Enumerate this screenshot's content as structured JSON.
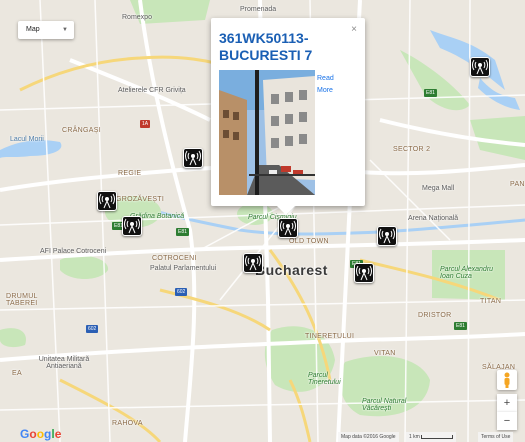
{
  "map_type": {
    "label": "Map"
  },
  "popup": {
    "title": "361WK50113-BUCURESTI 7",
    "read_more": "Read More",
    "close": "×"
  },
  "labels": {
    "romexpo": "Romexpo",
    "promenada": "Promenada",
    "atelierele": "Atelierele CFR Grivița",
    "lacul_morii": "Lacul Morii",
    "crangasi": "CRÂNGAȘI",
    "regie": "REGIE",
    "grozavesti": "GROZĂVEȘTI",
    "gradina_botanica": "Grădina Botanică",
    "afi": "AFI Palace Cotroceni",
    "cotroceni": "COTROCENI",
    "palatul": "Palatul Parlamentului",
    "parcul_cismigiu": "Parcul Cișmigiu",
    "old_town": "OLD TOWN",
    "bucharest": "Bucharest",
    "mega_mall": "Mega Mall",
    "arena": "Arena Națională",
    "sector2": "SECTOR 2",
    "pantelimon": "PAN",
    "drumul_taberei": "DRUMUL TABEREI",
    "parcul_alexandru": "Parcul Alexandru Ioan Cuza",
    "titan": "TITAN",
    "dristor": "DRISTOR",
    "tineretului": "TINERETULUI",
    "vitan": "VITAN",
    "unitatea": "Unitatea Militară Antiaeriană",
    "ea": "EA",
    "parcul_tineretului": "Parcul Tineretului",
    "parcul_vacaresti": "Parcul Natural Văcărești",
    "salajan": "SĂLAJAN",
    "rahova": "RAHOVA"
  },
  "road_badges": [
    "E81",
    "E81",
    "E81",
    "E81",
    "1A",
    "602",
    "602",
    "E81"
  ],
  "attribution": {
    "map_data": "Map data ©2016 Google",
    "scale": "1 km",
    "terms": "Terms of Use"
  },
  "zoom": {
    "in": "+",
    "out": "−"
  },
  "logo": [
    "G",
    "o",
    "o",
    "g",
    "l",
    "e"
  ],
  "colors": {
    "marker_bg": "#111111",
    "popup_title": "#1a5fb4",
    "park": "#c8e6b9",
    "water": "#a9d0f5"
  }
}
